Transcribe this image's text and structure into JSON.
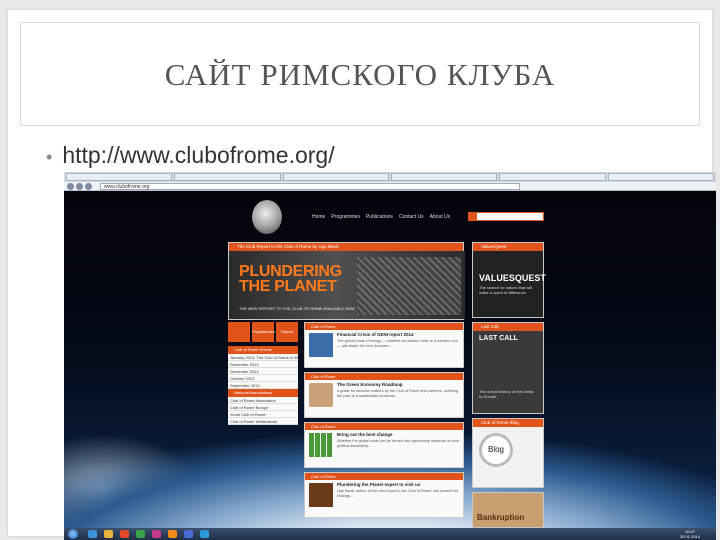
{
  "slide": {
    "title": "САЙТ РИМСКОГО КЛУБА",
    "bullet": "http://www.clubofrome.org/"
  },
  "browser": {
    "address": "www.clubofrome.org"
  },
  "site": {
    "nav": [
      "Home",
      "Programmes",
      "Publications",
      "Contact Us",
      "About Us"
    ],
    "hero_label": "The Club Report to the Club of Rome by Ugo Bardi",
    "hero_line1": "PLUNDERING",
    "hero_line2": "THE PLANET",
    "hero_sub": "THE NEW REPORT TO THE CLUB OF ROME AVAILABLE NOW",
    "right_ad1": {
      "head": "ValuesQuest",
      "title": "VALUESQUEST",
      "text": "The search for values that will make a world of difference"
    },
    "right_ad2": {
      "head": "Last Call",
      "title": "LAST CALL",
      "text": "The untold history of the Limits to Growth"
    },
    "right_ad3": {
      "head": "Club of Rome Blog",
      "title": "Blog"
    },
    "left_buttons": [
      "Programmes",
      "Report"
    ],
    "left_menu_head1": "Club of Rome Events",
    "left_menu1": [
      "January 2014: The Club of Rome in Winterthur",
      "December 2013",
      "November 2013",
      "October 2013",
      "September 2013"
    ],
    "left_menu_head2": "National Associations",
    "left_menu2": [
      "Club of Rome Association",
      "Club of Rome Europe",
      "Youth Club of Rome",
      "Club of Rome Netherlands"
    ],
    "posts": [
      {
        "head": "Club of Rome",
        "title": "Financial Crisis of GENI report 2014",
        "body": "The global crisis of energy — whether an eastern road or a western one — will shape the next decades..."
      },
      {
        "head": "Club of Rome",
        "title": "The Green Economy Roadmap",
        "body": "A guide for decision makers by the Club of Rome and partners, outlining the path to a sustainable economy..."
      },
      {
        "head": "Club of Rome",
        "title": "Bring out the best change",
        "body": "Whether the global crisis can be turned into opportunity depends on bold political leadership..."
      },
      {
        "head": "Club of Rome",
        "title": "Plundering the Planet expert to visit us",
        "body": "Ugo Bardi, author of the new report to the Club of Rome, will present his findings..."
      }
    ],
    "bottom_ad": "Bankruption"
  },
  "taskbar": {
    "time": "10:47",
    "date": "20.01.2014"
  },
  "colors": {
    "accent": "#e0541b",
    "hero_text": "#ff7a1a"
  }
}
